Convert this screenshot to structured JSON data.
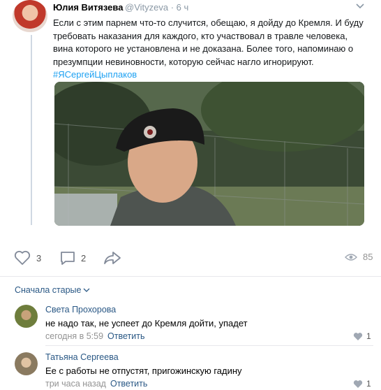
{
  "tweet": {
    "author_name": "Юлия Витязева",
    "author_handle": "@Vityzeva",
    "time": "6 ч",
    "text": "Если с этим парнем что-то случится, обещаю, я дойду до Кремля. И буду требовать наказания для каждого, кто участвовал в травле человека, вина которого не установлена и не доказана. Более того, напоминаю о презумпции невиновности, которую сейчас нагло игнорируют.",
    "hashtag": "#ЯСергейЦыплаков"
  },
  "actions": {
    "likes": "3",
    "comments": "2",
    "views": "85"
  },
  "comments_sort": "Сначала старые",
  "comments": [
    {
      "author": "Света Прохорова",
      "text": "не надо так, не успеет до Кремля дойти, упадет",
      "time": "сегодня в 5:59",
      "reply_label": "Ответить",
      "likes": "1"
    },
    {
      "author": "Татьяна Сергеева",
      "text": "Ее с работы не отпустят, пригожинскую гадину",
      "time": "три часа назад",
      "reply_label": "Ответить",
      "likes": "1"
    }
  ],
  "icons": {
    "heart": "heart-icon",
    "comment": "comment-icon",
    "share": "share-icon",
    "views": "eye-icon",
    "chevron": "chevron-down-icon",
    "like": "like-heart-icon"
  },
  "colors": {
    "link": "#2a5885",
    "hashtag": "#1da1f2",
    "muted": "#939393"
  }
}
